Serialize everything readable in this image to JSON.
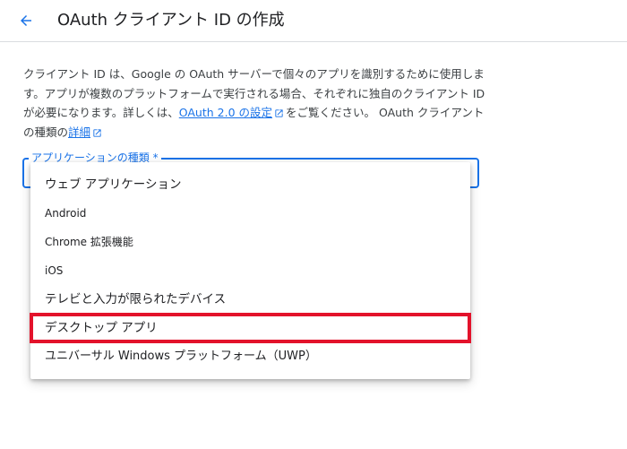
{
  "header": {
    "title": "OAuth クライアント ID の作成",
    "back_icon": "arrow-back-icon"
  },
  "description": {
    "text_1": "クライアント ID は、Google の OAuth サーバーで個々のアプリを識別するために使用します。アプリが複数のプラットフォームで実行される場合、それぞれに独自のクライアント ID が必要になります。詳しくは、",
    "link_1": "OAuth 2.0 の設定",
    "text_2": "をご覧ください。 OAuth クライアントの種類の",
    "link_2": "詳細"
  },
  "application_type": {
    "label": "アプリケーションの種類 *",
    "options": [
      "ウェブ アプリケーション",
      "Android",
      "Chrome 拡張機能",
      "iOS",
      "テレビと入力が限られたデバイス",
      "デスクトップ アプリ",
      "ユニバーサル Windows プラットフォーム（UWP）"
    ],
    "highlighted_option": "デスクトップ アプリ"
  },
  "colors": {
    "accent": "#1a73e8",
    "highlight_border": "#e3122b"
  }
}
